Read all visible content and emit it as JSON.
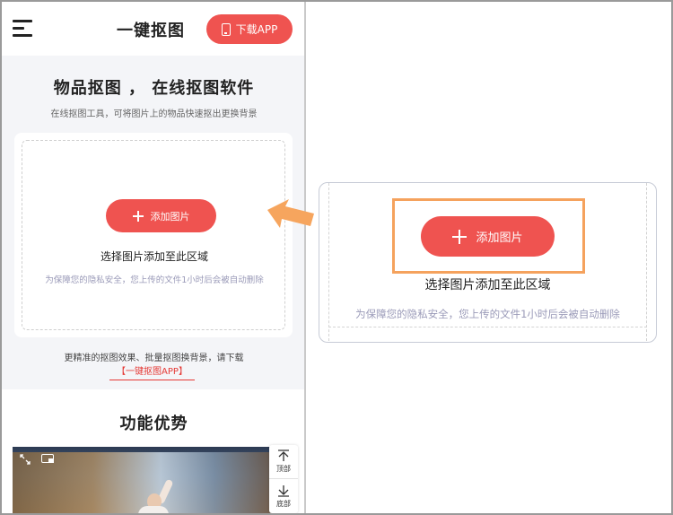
{
  "header": {
    "title": "一键抠图",
    "download_label": "下载APP"
  },
  "hero": {
    "title": "物品抠图 ， 在线抠图软件",
    "subtitle": "在线抠图工具，可将图片上的物品快速抠出更换背景"
  },
  "upload": {
    "add_label": "添加图片",
    "select_text": "选择图片添加至此区域",
    "privacy_note": "为保障您的隐私安全，您上传的文件1小时后会被自动删除"
  },
  "promo": {
    "text": "更精准的抠图效果、批量抠图换背景，请下载",
    "link": "【一键抠图APP】"
  },
  "features": {
    "title": "功能优势"
  },
  "side_float": {
    "top_label": "顶部",
    "bottom_label": "底部"
  },
  "zoom": {
    "add_label": "添加图片",
    "select_text": "选择图片添加至此区域",
    "privacy_note": "为保障您的隐私安全，您上传的文件1小时后会被自动删除"
  },
  "icons": {
    "menu": "menu-icon",
    "phone": "phone-icon",
    "plus": "plus-icon",
    "expand": "expand-icon",
    "compare": "compare-icon",
    "arrow_up": "arrow-up-icon",
    "arrow_down": "arrow-down-icon",
    "pointer_arrow": "pointer-arrow-icon"
  },
  "colors": {
    "brand_red": "#ef5350",
    "highlight_orange": "#f5a25d",
    "privacy_text": "#9a9ab8"
  }
}
